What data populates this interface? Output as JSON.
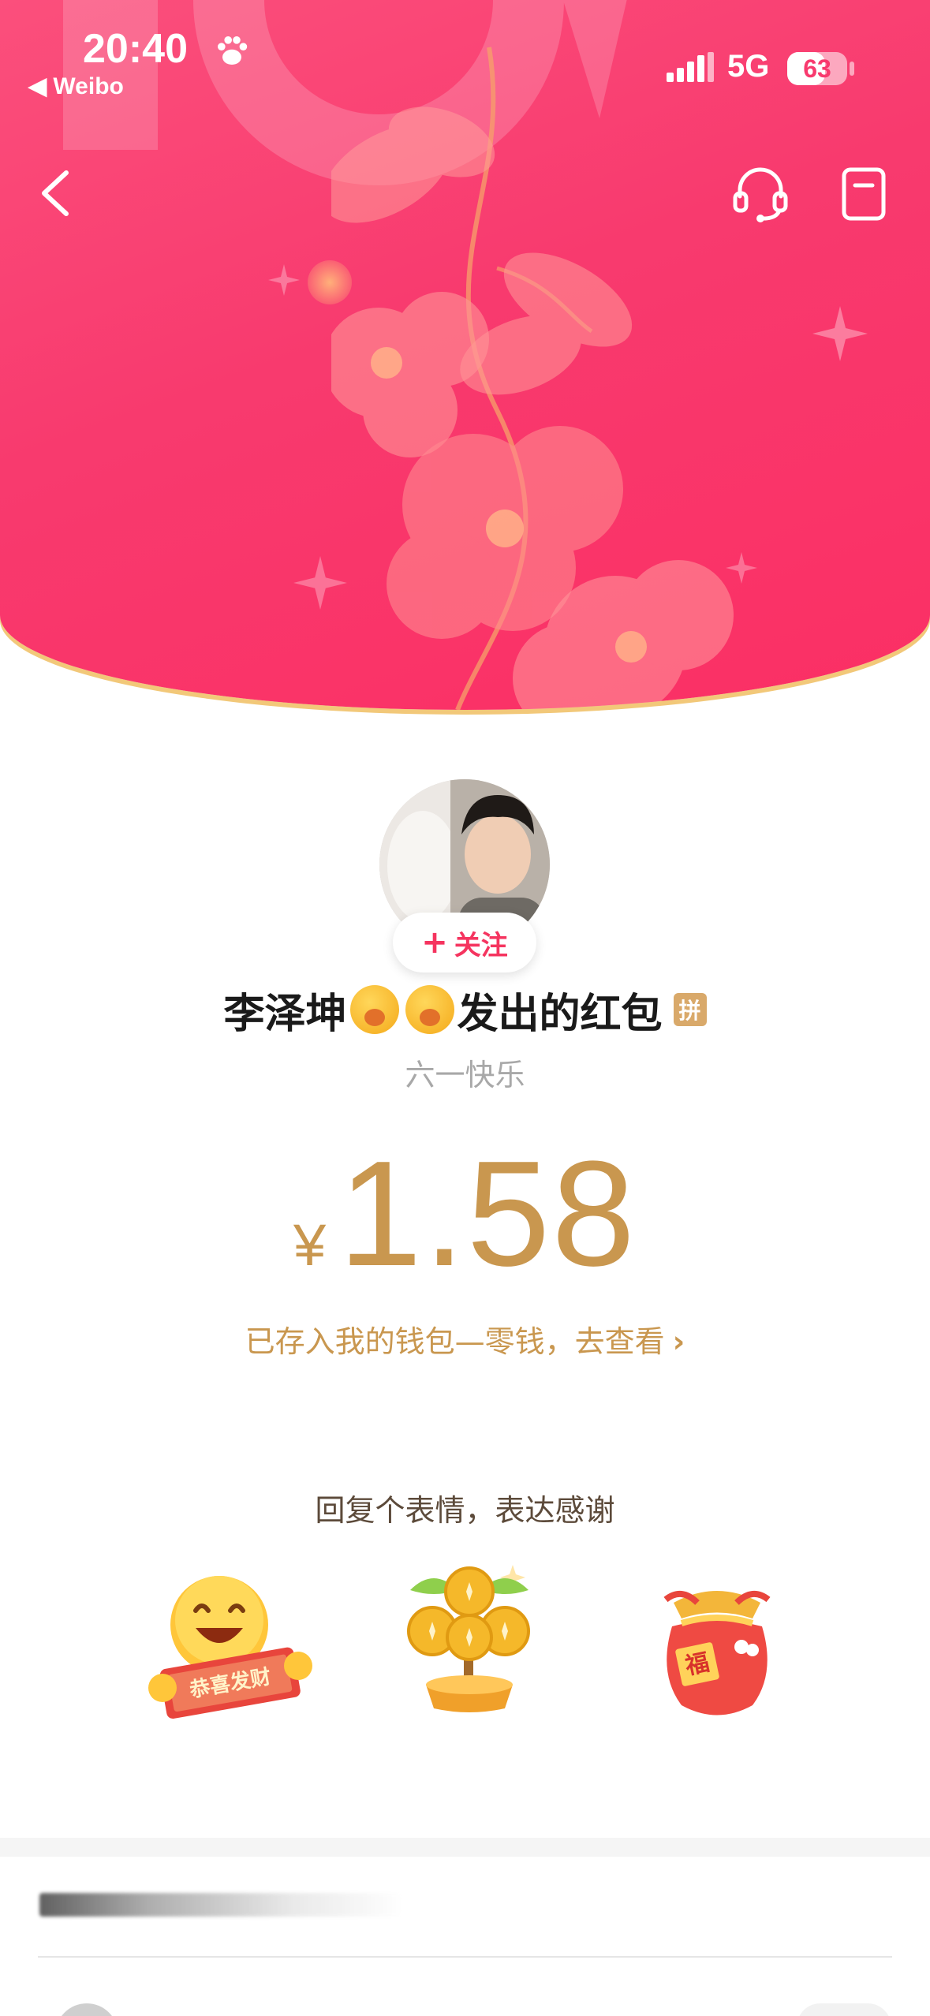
{
  "status_bar": {
    "time": "20:40",
    "back_app": "◀ Weibo",
    "network": "5G",
    "battery": "63",
    "battery_level": 0.63
  },
  "nav": {
    "back_icon": "chevron-left-icon",
    "support_icon": "headset-icon",
    "record_icon": "document-icon"
  },
  "sender": {
    "follow_label": "关注",
    "name_prefix": "李泽坤",
    "name_suffix": "发出的红包",
    "pin_badge": "拼",
    "greeting": "六一快乐"
  },
  "amount": {
    "currency": "¥",
    "value": "1.58"
  },
  "wallet_link": "已存入我的钱包—零钱，去查看",
  "reply": {
    "title": "回复个表情，表达感谢",
    "stickers": [
      {
        "name": "恭喜发财",
        "icon": "smiley-banner-sticker"
      },
      {
        "name": "money-tree",
        "icon": "money-tree-sticker"
      },
      {
        "name": "福",
        "icon": "lucky-bag-sticker"
      }
    ]
  },
  "colors": {
    "banner": "#f83a6e",
    "gold": "#c9974f",
    "follow": "#f5345f"
  }
}
